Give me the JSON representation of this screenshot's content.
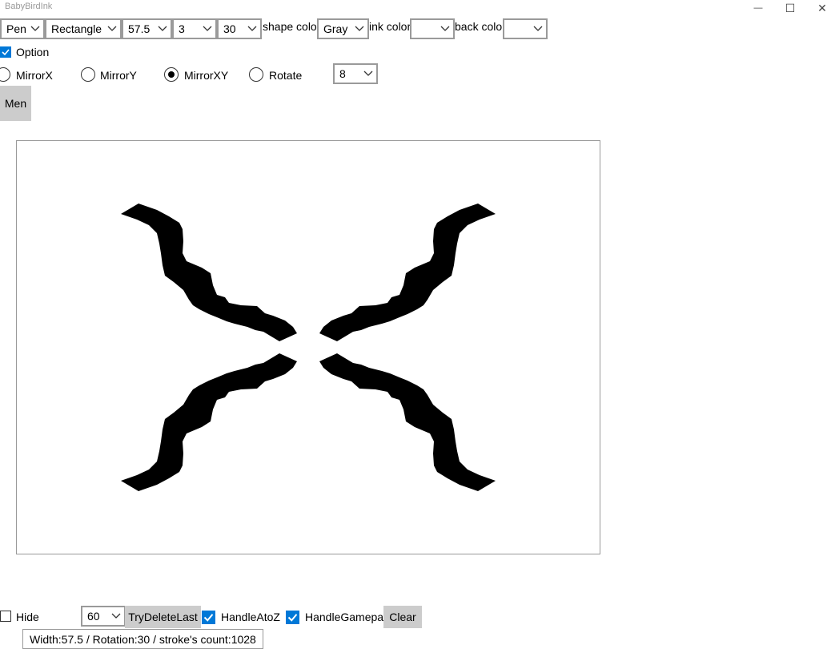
{
  "window": {
    "title": "BabyBirdInk",
    "minimize_glyph": "—",
    "maximize_glyph": "☐",
    "close_glyph": "✕"
  },
  "toolbar": {
    "tool_select": "Pen",
    "shape_select": "Rectangle",
    "width_select": "57.5",
    "count_select": "3",
    "rotation_select": "30",
    "shape_color_label": "shape color",
    "shape_color_select": "Gray",
    "ink_color_label": "ink color",
    "ink_color_select": "",
    "back_color_label": "back color",
    "back_color_select": ""
  },
  "option": {
    "label": "Option",
    "checked": true
  },
  "mirror": {
    "options": [
      "MirrorX",
      "MirrorY",
      "MirrorXY",
      "Rotate"
    ],
    "selected": "MirrorXY",
    "rotate_count": "8"
  },
  "menu_button": "Men",
  "bottom": {
    "hide_label": "Hide",
    "hide_checked": false,
    "interval_select": "60",
    "try_delete_label": "TryDeleteLast",
    "handle_atoz_label": "HandleAtoZ",
    "handle_atoz_checked": true,
    "handle_gamepad_label": "HandleGamepad",
    "handle_gamepad_checked": true,
    "clear_label": "Clear",
    "status_text": "Width:57.5 / Rotation:30 / stroke's count:1028"
  },
  "colors": {
    "accent": "#0078d7",
    "button_bg": "#cccccc",
    "border": "#9a9a9a",
    "ink": "#000000"
  }
}
